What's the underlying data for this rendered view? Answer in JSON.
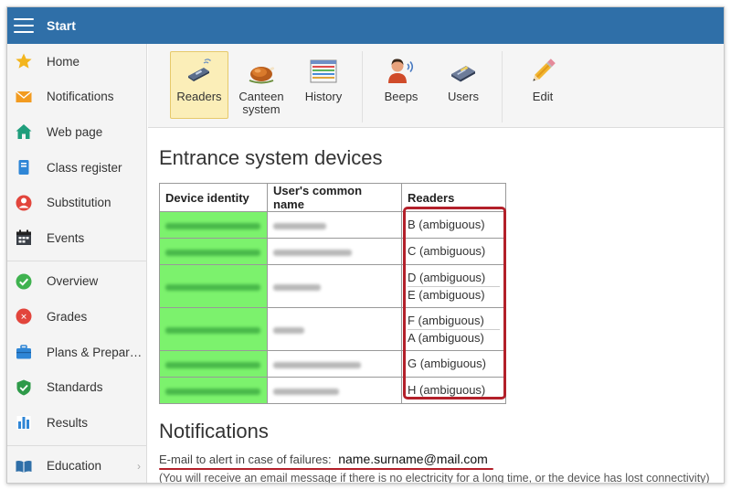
{
  "topbar": {
    "title": "Start"
  },
  "sidebar": {
    "items": [
      {
        "label": "Home",
        "icon": "star-icon"
      },
      {
        "label": "Notifications",
        "icon": "envelope-icon"
      },
      {
        "label": "Web page",
        "icon": "house-icon"
      },
      {
        "label": "Class register",
        "icon": "book-icon"
      },
      {
        "label": "Substitution",
        "icon": "person-icon"
      },
      {
        "label": "Events",
        "icon": "calendar-icon"
      },
      {
        "label": "Overview",
        "icon": "check-circle-icon"
      },
      {
        "label": "Grades",
        "icon": "grade-icon"
      },
      {
        "label": "Plans & Prepar…",
        "icon": "briefcase-icon"
      },
      {
        "label": "Standards",
        "icon": "shield-check-icon"
      },
      {
        "label": "Results",
        "icon": "bar-chart-icon"
      },
      {
        "label": "Education",
        "icon": "open-book-icon"
      }
    ]
  },
  "toolbar": {
    "readers": "Readers",
    "canteen": "Canteen system",
    "history": "History",
    "beeps": "Beeps",
    "users": "Users",
    "edit": "Edit"
  },
  "page": {
    "title": "Entrance system devices",
    "table": {
      "headers": [
        "Device identity",
        "User's common name",
        "Readers"
      ],
      "rows": [
        {
          "readers": [
            "B  (ambiguous)"
          ]
        },
        {
          "readers": [
            "C  (ambiguous)"
          ]
        },
        {
          "readers": [
            "D  (ambiguous)",
            "E  (ambiguous)"
          ]
        },
        {
          "readers": [
            "F  (ambiguous)",
            "A  (ambiguous)"
          ]
        },
        {
          "readers": [
            "G  (ambiguous)"
          ]
        },
        {
          "readers": [
            "H  (ambiguous)"
          ]
        }
      ]
    },
    "notifications": {
      "title": "Notifications",
      "email_label": "E-mail to alert in case of failures:",
      "email_value": "name.surname@mail.com",
      "note": "(You will receive an email message if there is no electricity for a long time, or the device has lost connectivity)"
    }
  },
  "colors": {
    "accent": "#2f6fa8",
    "highlight": "#b3202a",
    "device_cell": "#7cf26d"
  }
}
